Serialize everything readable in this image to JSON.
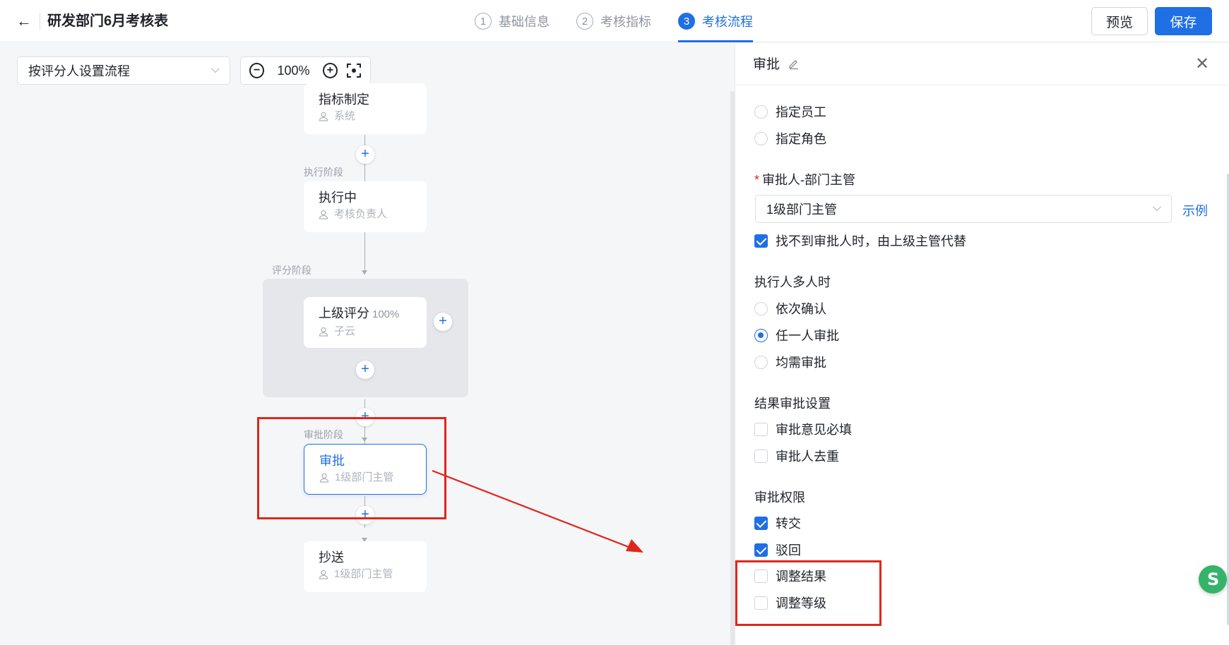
{
  "header": {
    "title": "研发部门6月考核表",
    "steps": [
      {
        "num": "1",
        "label": "基础信息"
      },
      {
        "num": "2",
        "label": "考核指标"
      },
      {
        "num": "3",
        "label": "考核流程"
      }
    ],
    "active_step": 3,
    "preview_label": "预览",
    "save_label": "保存"
  },
  "canvas": {
    "flow_mode": "按评分人设置流程",
    "zoom": "100%",
    "stage_labels": {
      "execute": "执行阶段",
      "score": "评分阶段",
      "approve": "审批阶段"
    },
    "nodes": [
      {
        "title": "指标制定",
        "assignee": "系统"
      },
      {
        "title": "执行中",
        "assignee": "考核负责人"
      },
      {
        "title": "上级评分",
        "weight": "100%",
        "assignee": "子云"
      },
      {
        "title": "审批",
        "assignee": "1级部门主管"
      },
      {
        "title": "抄送",
        "assignee": "1级部门主管"
      }
    ]
  },
  "panel": {
    "title": "审批",
    "assign_options": [
      {
        "label": "指定员工",
        "selected": false
      },
      {
        "label": "指定角色",
        "selected": false
      }
    ],
    "approver_label": "审批人-部门主管",
    "approver_value": "1级部门主管",
    "example_link": "示例",
    "fallback_label": "找不到审批人时，由上级主管代替",
    "fallback_checked": true,
    "multi_label": "执行人多人时",
    "multi_options": [
      {
        "label": "依次确认",
        "selected": false
      },
      {
        "label": "任一人审批",
        "selected": true
      },
      {
        "label": "均需审批",
        "selected": false
      }
    ],
    "result_label": "结果审批设置",
    "result_options": [
      {
        "label": "审批意见必填",
        "checked": false
      },
      {
        "label": "审批人去重",
        "checked": false
      }
    ],
    "perm_label": "审批权限",
    "perm_options": [
      {
        "label": "转交",
        "checked": true
      },
      {
        "label": "驳回",
        "checked": true
      },
      {
        "label": "调整结果",
        "checked": false
      },
      {
        "label": "调整等级",
        "checked": false
      }
    ]
  },
  "colors": {
    "accent": "#1f6fe5",
    "highlight": "#e0261b"
  }
}
